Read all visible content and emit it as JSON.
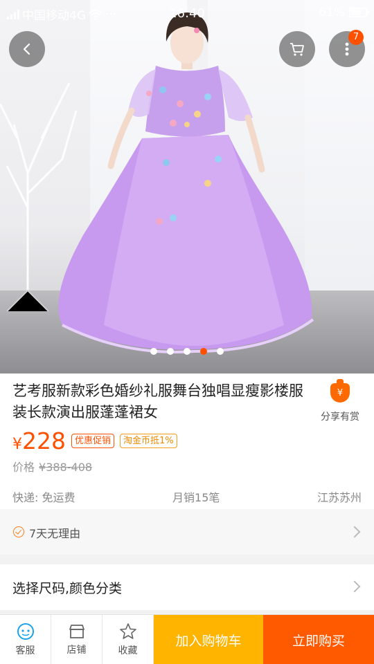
{
  "status_bar": {
    "carrier": "中国移动4G",
    "more": "···",
    "time": "16:40",
    "battery": "61%"
  },
  "header": {
    "cart_badge": "7"
  },
  "gallery": {
    "image_count": 5,
    "active_index": 3
  },
  "product": {
    "title": "艺考服新款彩色婚纱礼服舞台独唱显瘦影楼服装长款演出服蓬蓬裙女",
    "share_label": "分享有赏",
    "share_icon_text": "¥",
    "currency": "¥",
    "price": "228",
    "tags": [
      "优惠促销",
      "淘金币抵1%"
    ],
    "original_price_label": "价格",
    "original_price": "¥388-408",
    "shipping": "快递: 免运费",
    "monthly_sales": "月销15笔",
    "location": "江苏苏州"
  },
  "guarantee": {
    "text": "7天无理由"
  },
  "options": {
    "text": "选择尺码,颜色分类"
  },
  "bottom_bar": {
    "service": "客服",
    "shop": "店铺",
    "favorite": "收藏",
    "add_to_cart": "加入购物车",
    "buy_now": "立即购买"
  },
  "colors": {
    "accent": "#ff5000",
    "cart_button": "#ffb400",
    "buy_button": "#ff5a00",
    "coin_tag": "#f49c1b"
  },
  "icons": [
    "back-arrow-icon",
    "cart-icon",
    "more-icon",
    "share-bag-icon",
    "check-circle-icon",
    "chevron-right-icon",
    "service-icon",
    "shop-icon",
    "star-icon"
  ]
}
